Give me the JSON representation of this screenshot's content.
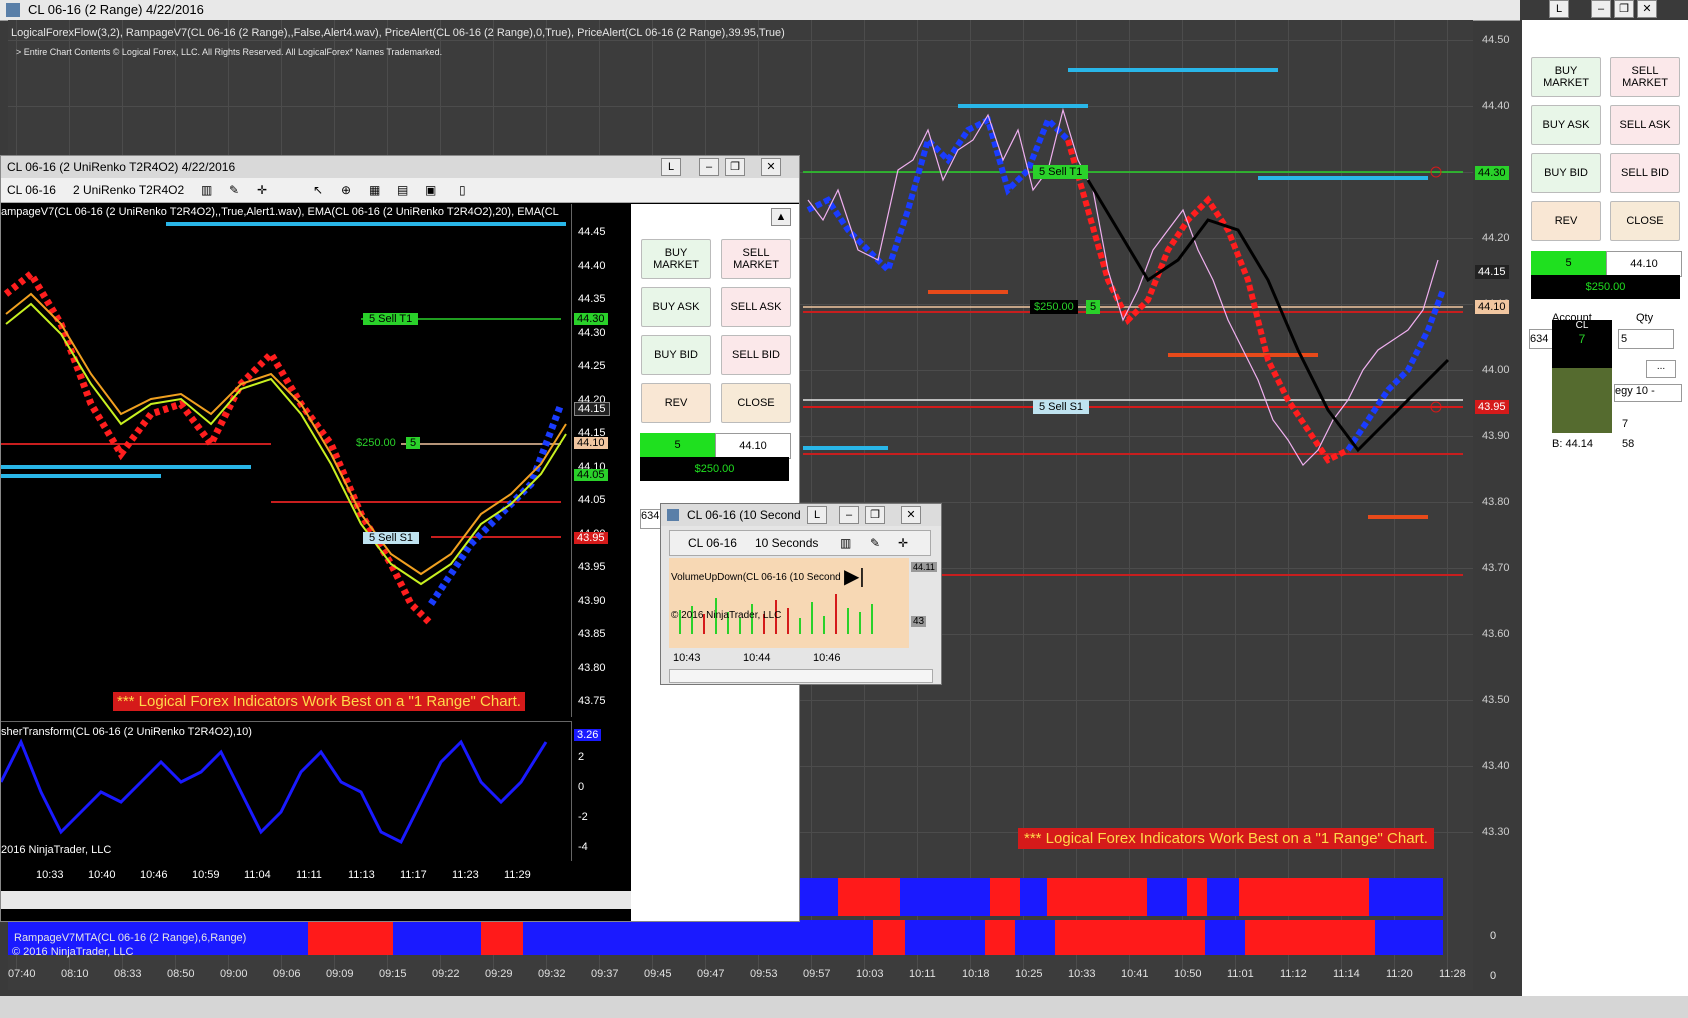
{
  "main_window": {
    "title": "CL 06-16 (2 Range)  4/22/2016",
    "indicator_line": "LogicalForexFlow(3,2), RampageV7(CL 06-16 (2 Range),,False,Alert4.wav), PriceAlert(CL 06-16 (2 Range),0,True), PriceAlert(CL 06-16 (2 Range),39.95,True)",
    "copyright_line": "> Entire Chart Contents © Logical Forex, LLC. All Rights Reserved. All LogicalForex* Names Trademarked.",
    "y_labels": [
      "44.50",
      "44.40",
      "44.30",
      "44.20",
      "44.10",
      "44.00",
      "43.90",
      "43.80",
      "43.70",
      "43.60",
      "43.50",
      "43.40",
      "43.30"
    ],
    "x_labels": [
      "07:40",
      "08:10",
      "08:33",
      "08:50",
      "09:00",
      "09:06",
      "09:09",
      "09:15",
      "09:22",
      "09:29",
      "09:32",
      "09:37",
      "09:45",
      "09:47",
      "09:53",
      "09:57",
      "10:03",
      "10:11",
      "10:18",
      "10:25",
      "10:33",
      "10:41",
      "10:50",
      "11:01",
      "11:12",
      "11:14",
      "11:20",
      "11:28"
    ],
    "price_tags": {
      "sell_t1": "44.30",
      "last": "44.15",
      "position": "44.10",
      "sell_s1": "43.95"
    },
    "sell_t1_label": "5  Sell T1",
    "sell_s1_label": "5  Sell S1",
    "pnl_label": "$250.00",
    "pnl_qty": "5",
    "banner": "*** Logical Forex Indicators Work Best on a \"1 Range\" Chart.",
    "mta_label": "RampageV7MTA(CL 06-16 (2 Range),6,Range)",
    "mta_copyright": "© 2016 NinjaTrader, LLC",
    "mta_zero": "0",
    "link_btn": "L"
  },
  "order_panel": {
    "buy_market": "BUY MARKET",
    "sell_market": "SELL MARKET",
    "buy_ask": "BUY ASK",
    "sell_ask": "SELL ASK",
    "buy_bid": "BUY BID",
    "sell_bid": "SELL BID",
    "rev": "REV",
    "close": "CLOSE",
    "position_qty": "5",
    "position_price": "44.10",
    "pnl": "$250.00",
    "account_label": "Account",
    "qty_label": "Qty",
    "qty_value": "5",
    "account_value": "634",
    "instrument": "CL",
    "instrument_count": "7",
    "strategy": "egy 10 -",
    "ellipsis": "...",
    "ask_count": "7",
    "bid_price": "B: 44.14",
    "bid_count": "58"
  },
  "renko_window": {
    "title": "CL 06-16 (2 UniRenko T2R4O2)  4/22/2016",
    "instrument": "CL 06-16",
    "bar_type": "2 UniRenko T2R4O2",
    "indicator_line": "ampageV7(CL 06-16 (2 UniRenko T2R4O2),,True,Alert1.wav), EMA(CL 06-16 (2 UniRenko T2R4O2),20), EMA(CL",
    "y_labels": [
      "44.45",
      "44.40",
      "44.35",
      "44.30",
      "44.25",
      "44.20",
      "44.15",
      "44.10",
      "44.05",
      "44.00",
      "43.95",
      "43.90",
      "43.85",
      "43.80",
      "43.75"
    ],
    "x_labels": [
      "10:33",
      "10:40",
      "10:46",
      "10:59",
      "11:04",
      "11:11",
      "11:13",
      "11:17",
      "11:23",
      "11:29"
    ],
    "sell_t1_label": "5  Sell T1",
    "sell_s1_label": "5  Sell S1",
    "pnl_label": "$250.00",
    "pnl_qty": "5",
    "tags": {
      "t1": "44.30",
      "last": "44.15",
      "pos": "44.10",
      "ema": "44.05",
      "s1": "43.95"
    },
    "banner": "*** Logical Forex Indicators Work Best on a \"1 Range\" Chart.",
    "fisher_label": "sherTransform(CL 06-16 (2 UniRenko T2R4O2),10)",
    "fisher_value": "3.26",
    "fisher_ticks": [
      "2",
      "0",
      "-2",
      "-4"
    ],
    "copyright": "2016 NinjaTrader, LLC",
    "buttons": {
      "buy_market": "BUY MARKET",
      "sell_market": "SELL MARKET",
      "buy_ask": "BUY ASK",
      "sell_ask": "SELL ASK",
      "buy_bid": "BUY BID",
      "sell_bid": "SELL BID",
      "rev": "REV",
      "close": "CLOSE"
    },
    "position_qty": "5",
    "position_price": "44.10",
    "pnl": "$250.00",
    "account_value": "634",
    "link_btn": "L"
  },
  "mini_window": {
    "title": "CL 06-16 (10 Second",
    "instrument": "CL 06-16",
    "interval": "10 Seconds",
    "indicator": "VolumeUpDown(CL 06-16 (10 Second",
    "copyright": "© 2016 NinjaTrader, LLC",
    "x_labels": [
      "10:43",
      "10:44",
      "10:46"
    ],
    "tag_top": "44.11",
    "tag_bottom": "43",
    "link_btn": "L"
  }
}
